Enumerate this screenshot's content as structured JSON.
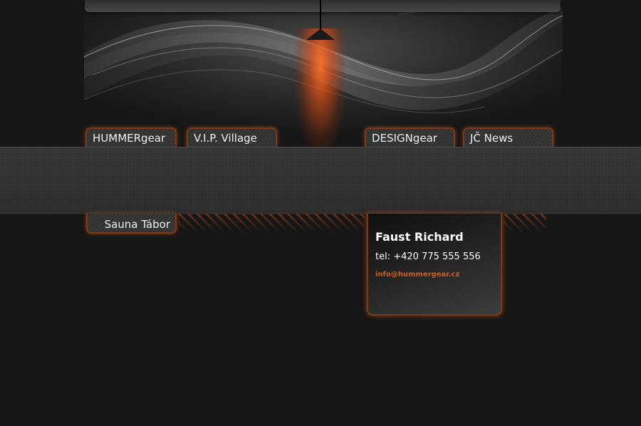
{
  "nav": {
    "tabs": [
      {
        "label": "HUMMERgear"
      },
      {
        "label": "V.I.P. Village"
      },
      {
        "label": "DESIGNgear"
      },
      {
        "label": "JČ News"
      }
    ],
    "bottom_tab": {
      "label": "Sauna Tábor"
    }
  },
  "contact": {
    "name": "Faust Richard",
    "tel": "tel: +420 775 555 556",
    "email": "info@hummergear.cz"
  },
  "colors": {
    "accent": "#d65a1c",
    "background": "#161616",
    "band": "#2e2e2e"
  }
}
